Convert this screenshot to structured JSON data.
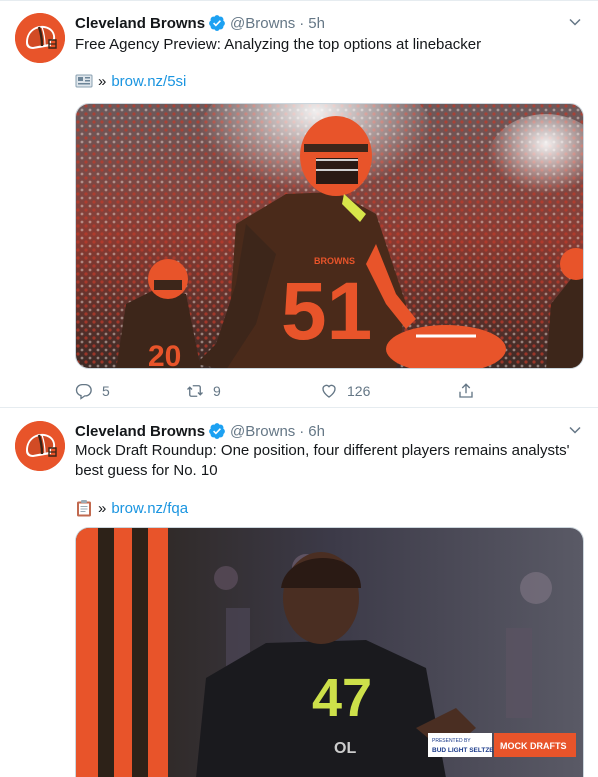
{
  "tweets": [
    {
      "author_name": "Cleveland Browns",
      "handle": "@Browns",
      "separator": "·",
      "time": "5h",
      "text": "Free Agency Preview: Analyzing the top options at linebacker",
      "link_prefix": "»",
      "link": "brow.nz/5si",
      "link_emoji_icon": "newspaper-icon",
      "media_image": "player-51-stadium-photo",
      "replies": "5",
      "retweets": "9",
      "likes": "126"
    },
    {
      "author_name": "Cleveland Browns",
      "handle": "@Browns",
      "separator": "·",
      "time": "6h",
      "text": "Mock Draft Roundup: One position, four different players remains analysts' best guess for No. 10",
      "link_prefix": "»",
      "link": "brow.nz/fqa",
      "link_emoji_icon": "clipboard-icon",
      "media_image": "player-47-combine-photo",
      "media_badge": "MOCK DRAFTS",
      "media_sponsor": "BUD LIGHT SELTZER"
    }
  ],
  "colors": {
    "link": "#1b95e0",
    "muted": "#657786",
    "browns_orange": "#e8542a",
    "browns_brown": "#4a2a1a"
  }
}
